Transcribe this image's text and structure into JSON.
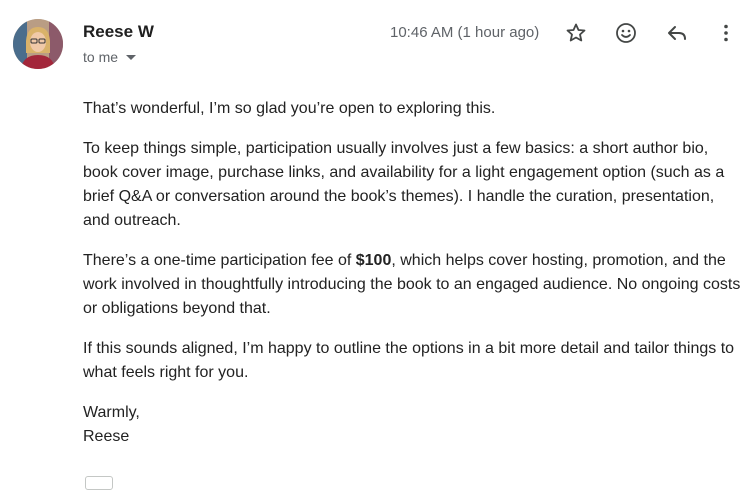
{
  "email": {
    "sender": "Reese W",
    "recipient_label": "to me",
    "timestamp": "10:46 AM (1 hour ago)",
    "icons": [
      "star-icon",
      "emoji-icon",
      "reply-icon",
      "more-vert-icon"
    ],
    "paragraphs": [
      "That’s wonderful,  I’m so glad you’re open to exploring this.",
      "To keep things simple, participation usually involves just a few basics: a short author bio, book cover image, purchase links, and availability for a light engagement option (such as a brief Q&A or conversation around the book’s themes). I handle the curation, presentation, and outreach."
    ],
    "fee": {
      "before": "There’s a one-time participation fee of ",
      "amount": "$100",
      "after": ", which helps cover hosting, promotion, and the work involved in thoughtfully introducing the book to an engaged audience. No ongoing costs or obligations beyond that."
    },
    "closing_paragraph": "If this sounds aligned, I’m happy to outline the options in a bit more detail and tailor things to what feels right for you.",
    "signoff": "Warmly,",
    "signature": "Reese"
  }
}
